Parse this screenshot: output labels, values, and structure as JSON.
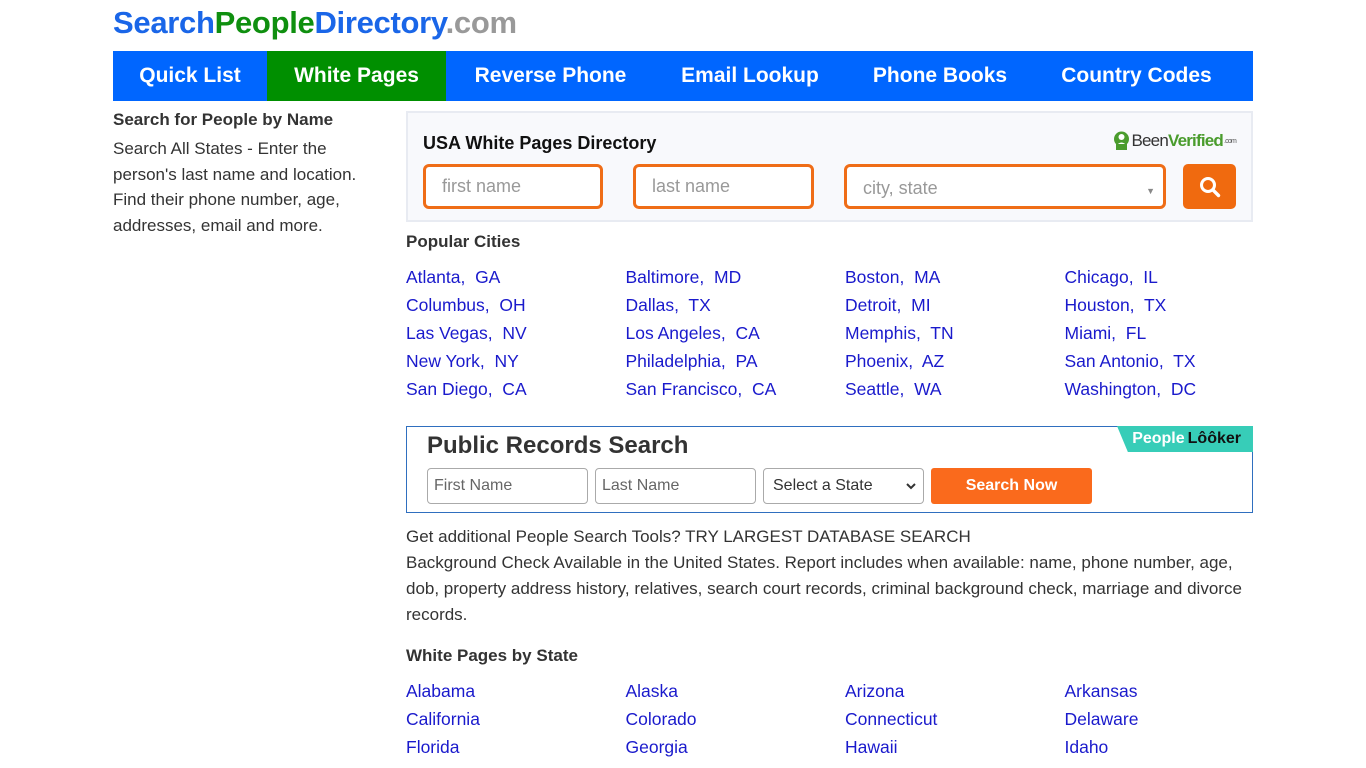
{
  "logo": {
    "part1": "Search",
    "part2": "People",
    "part3": "Directory",
    "part4": ".com"
  },
  "nav": {
    "items": [
      {
        "label": "Quick List",
        "active": false
      },
      {
        "label": "White Pages",
        "active": true
      },
      {
        "label": "Reverse Phone",
        "active": false
      },
      {
        "label": "Email Lookup",
        "active": false
      },
      {
        "label": "Phone Books",
        "active": false
      },
      {
        "label": "Country Codes",
        "active": false
      }
    ]
  },
  "sidebar": {
    "title": "Search for People by Name",
    "text": "Search All States - Enter the person's last name and location. Find their phone number, age, addresses, email and more."
  },
  "white_pages_search": {
    "title": "USA White Pages Directory",
    "partner_been": "Been",
    "partner_verified": "Verified",
    "partner_dot": ".com",
    "first_name_placeholder": "first name",
    "last_name_placeholder": "last name",
    "city_state_placeholder": "city, state",
    "search_icon": "search-icon"
  },
  "popular_cities": {
    "title": "Popular Cities",
    "items": [
      "Atlanta,  GA",
      "Baltimore,  MD",
      "Boston,  MA",
      "Chicago,  IL",
      "Columbus,  OH",
      "Dallas,  TX",
      "Detroit,  MI",
      "Houston,  TX",
      "Las Vegas,  NV",
      "Los Angeles,  CA",
      "Memphis,  TN",
      "Miami,  FL",
      "New York,  NY",
      "Philadelphia,  PA",
      "Phoenix,  AZ",
      "San Antonio,  TX",
      "San Diego,  CA",
      "San Francisco,  CA",
      "Seattle,  WA",
      "Washington,  DC"
    ]
  },
  "public_records": {
    "title": "Public Records Search",
    "partner_people": "People",
    "partner_looker": "Lôôker",
    "first_name_placeholder": "First Name",
    "last_name_placeholder": "Last Name",
    "state_select_value": "Select a State",
    "search_button": "Search Now"
  },
  "info": {
    "line1": "Get additional People Search Tools? TRY LARGEST DATABASE SEARCH",
    "line2": "Background Check Available in the United States. Report includes when available: name, phone number, age, dob, property address history, relatives, search court records, criminal background check, marriage and divorce records."
  },
  "states": {
    "title": "White Pages by State",
    "items": [
      "Alabama",
      "Alaska",
      "Arizona",
      "Arkansas",
      "California",
      "Colorado",
      "Connecticut",
      "Delaware",
      "Florida",
      "Georgia",
      "Hawaii",
      "Idaho"
    ]
  },
  "colors": {
    "nav_blue": "#0066ff",
    "nav_active_green": "#008f00",
    "accent_orange": "#ef6d17",
    "link_blue": "#1a1acc",
    "peoplelooker_teal": "#37cdb8"
  }
}
